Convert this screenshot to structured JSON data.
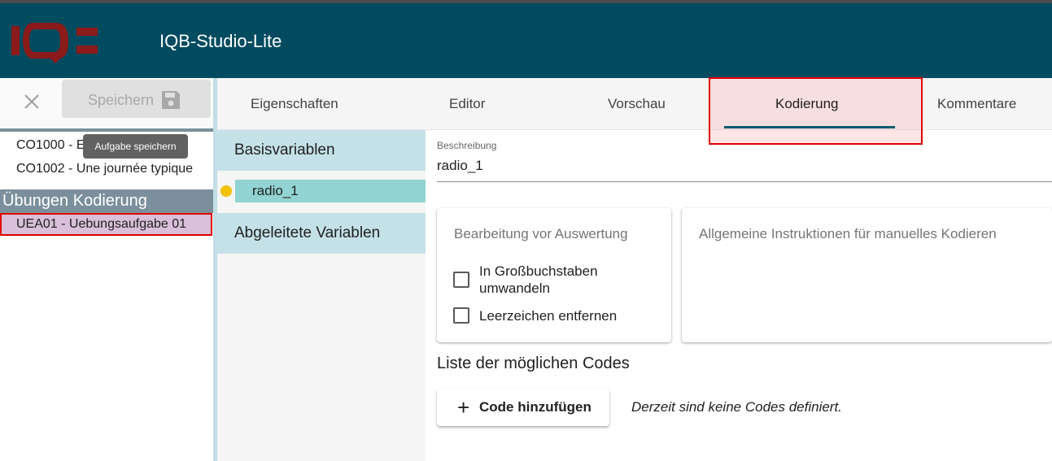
{
  "app": {
    "title": "IQB-Studio-Lite",
    "logo_text": "IQB"
  },
  "toolbar": {
    "save_label": "Speichern",
    "tooltip": "Aufgabe speichern"
  },
  "units": [
    {
      "label": "CO1000 - Exercice"
    },
    {
      "label": "CO1002 - Une journée typique"
    }
  ],
  "group": {
    "label": "Übungen Kodierung",
    "selected_unit": "UEA01 - Uebungsaufgabe 01"
  },
  "tabs": [
    {
      "label": "Eigenschaften"
    },
    {
      "label": "Editor"
    },
    {
      "label": "Vorschau"
    },
    {
      "label": "Kodierung"
    },
    {
      "label": "Kommentare"
    }
  ],
  "variables": {
    "base_header": "Basisvariablen",
    "items": [
      {
        "label": "radio_1"
      }
    ],
    "derived_header": "Abgeleitete Variablen"
  },
  "description": {
    "label": "Beschreibung",
    "value": "radio_1"
  },
  "processing": {
    "title": "Bearbeitung vor Auswertung",
    "options": [
      {
        "label": "In Großbuchstaben umwandeln",
        "checked": false
      },
      {
        "label": "Leerzeichen entfernen",
        "checked": false
      }
    ]
  },
  "instructions": {
    "title": "Allgemeine Instruktionen für manuelles Kodieren"
  },
  "codes": {
    "title": "Liste der möglichen Codes",
    "add_label": "Code hinzufügen",
    "empty_text": "Derzeit sind keine Codes definiert."
  },
  "colors": {
    "appbar": "#004b5f",
    "accent": "#005a6e",
    "highlight_border": "#e00000",
    "variable_selected": "#92d3d3",
    "status_dot": "#f2c200"
  }
}
